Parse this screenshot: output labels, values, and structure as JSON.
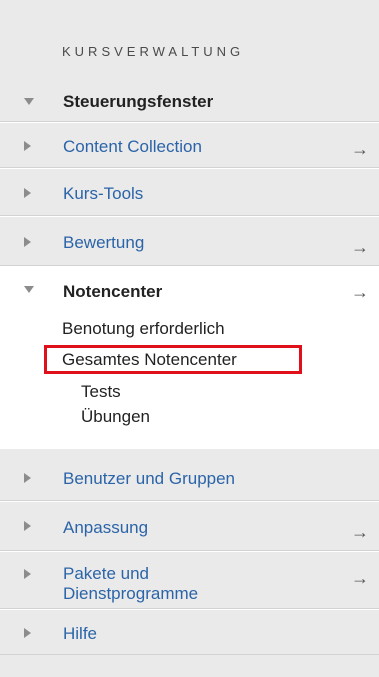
{
  "menu": {
    "heading": "KURSVERWALTUNG",
    "items": [
      {
        "label": "Steuerungsfenster",
        "expanded": true,
        "bold": true,
        "arrow": false
      },
      {
        "label": "Content Collection",
        "expanded": false,
        "arrow": true
      },
      {
        "label": "Kurs-Tools",
        "expanded": false,
        "arrow": false
      },
      {
        "label": "Bewertung",
        "expanded": false,
        "arrow": true
      },
      {
        "label": "Notencenter",
        "expanded": true,
        "bold": true,
        "arrow": true
      },
      {
        "label": "Benutzer und Gruppen",
        "expanded": false,
        "arrow": false
      },
      {
        "label": "Anpassung",
        "expanded": false,
        "arrow": true
      },
      {
        "label_line1": "Pakete und",
        "label_line2": "Dienstprogramme",
        "expanded": false,
        "arrow": true
      },
      {
        "label": "Hilfe",
        "expanded": false,
        "arrow": false
      }
    ],
    "arrow_glyph": "→",
    "notencenter_subitems": [
      "Benotung erforderlich",
      "Gesamtes Notencenter",
      "Tests",
      "Übungen"
    ],
    "highlighted_item": "Gesamtes Notencenter",
    "highlight_color": "#e0101a",
    "link_color": "#2b64a8"
  }
}
